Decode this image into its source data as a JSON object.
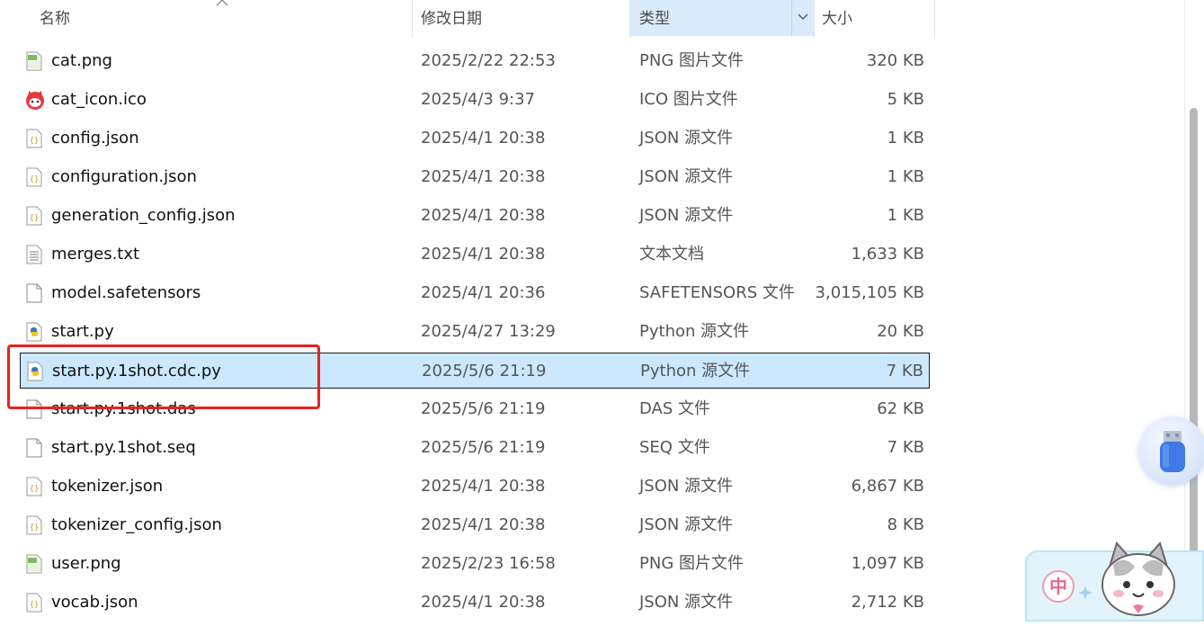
{
  "header": {
    "name_label": "名称",
    "date_label": "修改日期",
    "type_label": "类型",
    "size_label": "大小"
  },
  "files": [
    {
      "name": "cat.png",
      "date": "2025/2/22 22:53",
      "type": "PNG 图片文件",
      "size": "320 KB",
      "icon": "png-file-icon"
    },
    {
      "name": "cat_icon.ico",
      "date": "2025/4/3 9:37",
      "type": "ICO 图片文件",
      "size": "5 KB",
      "icon": "cat-face-icon"
    },
    {
      "name": "config.json",
      "date": "2025/4/1 20:38",
      "type": "JSON 源文件",
      "size": "1 KB",
      "icon": "json-file-icon"
    },
    {
      "name": "configuration.json",
      "date": "2025/4/1 20:38",
      "type": "JSON 源文件",
      "size": "1 KB",
      "icon": "json-file-icon"
    },
    {
      "name": "generation_config.json",
      "date": "2025/4/1 20:38",
      "type": "JSON 源文件",
      "size": "1 KB",
      "icon": "json-file-icon"
    },
    {
      "name": "merges.txt",
      "date": "2025/4/1 20:38",
      "type": "文本文档",
      "size": "1,633 KB",
      "icon": "text-file-icon"
    },
    {
      "name": "model.safetensors",
      "date": "2025/4/1 20:36",
      "type": "SAFETENSORS 文件",
      "size": "3,015,105 KB",
      "icon": "blank-file-icon"
    },
    {
      "name": "start.py",
      "date": "2025/4/27 13:29",
      "type": "Python 源文件",
      "size": "20 KB",
      "icon": "python-file-icon"
    },
    {
      "name": "start.py.1shot.cdc.py",
      "date": "2025/5/6 21:19",
      "type": "Python 源文件",
      "size": "7 KB",
      "icon": "python-file-icon",
      "selected": true
    },
    {
      "name": "start.py.1shot.das",
      "date": "2025/5/6 21:19",
      "type": "DAS 文件",
      "size": "62 KB",
      "icon": "blank-file-icon"
    },
    {
      "name": "start.py.1shot.seq",
      "date": "2025/5/6 21:19",
      "type": "SEQ 文件",
      "size": "7 KB",
      "icon": "blank-file-icon"
    },
    {
      "name": "tokenizer.json",
      "date": "2025/4/1 20:38",
      "type": "JSON 源文件",
      "size": "6,867 KB",
      "icon": "json-file-icon"
    },
    {
      "name": "tokenizer_config.json",
      "date": "2025/4/1 20:38",
      "type": "JSON 源文件",
      "size": "8 KB",
      "icon": "json-file-icon"
    },
    {
      "name": "user.png",
      "date": "2025/2/23 16:58",
      "type": "PNG 图片文件",
      "size": "1,097 KB",
      "icon": "png-file-icon"
    },
    {
      "name": "vocab.json",
      "date": "2025/4/1 20:38",
      "type": "JSON 源文件",
      "size": "2,712 KB",
      "icon": "json-file-icon"
    }
  ],
  "ime": {
    "mode_char": "中"
  },
  "colors": {
    "selection_bg": "#cce8ff",
    "header_active_bg": "#d9ebfb",
    "highlight_box": "#e8221f"
  }
}
